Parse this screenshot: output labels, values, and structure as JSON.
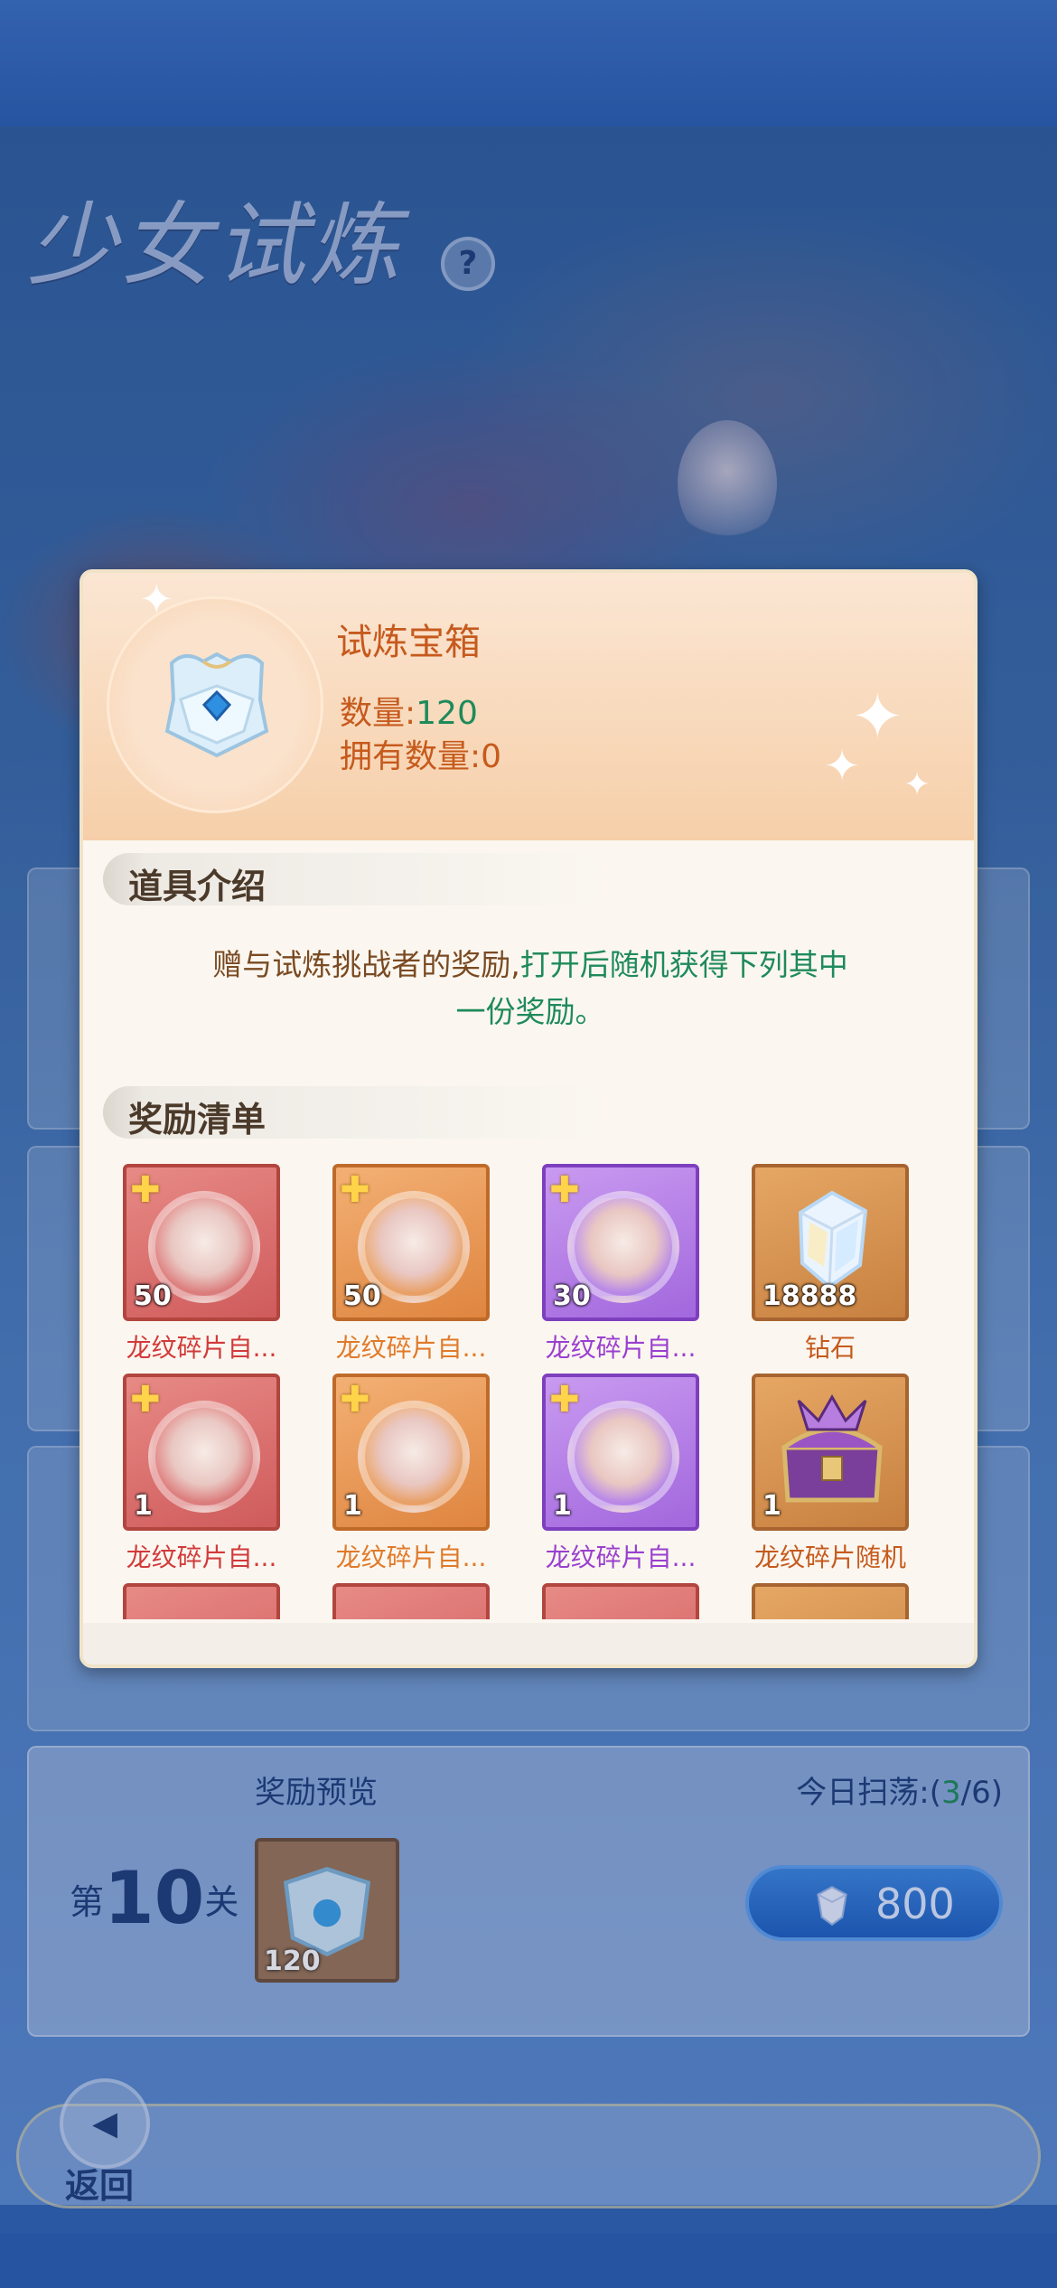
{
  "background": {
    "game_title": "少女试炼",
    "help_icon": "?",
    "stage": {
      "level_prefix": "第",
      "level_number": "10",
      "level_suffix": "关",
      "preview_label": "奖励预览",
      "sweep_label": "今日扫荡:(",
      "sweep_count": "3",
      "sweep_total": "/6)",
      "preview_item_count": "120",
      "cost_value": "800"
    },
    "return_label": "返回"
  },
  "modal": {
    "item_title": "试炼宝箱",
    "qty_label": "数量:",
    "qty_value": "120",
    "owned_label": "拥有数量:",
    "owned_value": "0",
    "intro_heading": "道具介绍",
    "intro_text_brown": "赠与试炼挑战者的奖励,",
    "intro_text_green_1": "打开后随机获得下列其中",
    "intro_text_green_2": "一份奖励。",
    "rewards_heading": "奖励清单",
    "rewards": [
      {
        "name": "龙纹碎片自...",
        "count": "50",
        "rarity": "red"
      },
      {
        "name": "龙纹碎片自...",
        "count": "50",
        "rarity": "orange"
      },
      {
        "name": "龙纹碎片自...",
        "count": "30",
        "rarity": "purple"
      },
      {
        "name": "钻石",
        "count": "18888",
        "rarity": "gold"
      },
      {
        "name": "龙纹碎片自...",
        "count": "1",
        "rarity": "red"
      },
      {
        "name": "龙纹碎片自...",
        "count": "1",
        "rarity": "orange"
      },
      {
        "name": "龙纹碎片自...",
        "count": "1",
        "rarity": "purple"
      },
      {
        "name": "龙纹碎片随机",
        "count": "1",
        "rarity": "gold"
      }
    ],
    "colors": {
      "title_orange": "#c65a1d",
      "value_green": "#1f8a5a",
      "rarity_red": "#d23a3a",
      "rarity_orange": "#e07a2a",
      "rarity_purple": "#9a3fd0"
    }
  }
}
